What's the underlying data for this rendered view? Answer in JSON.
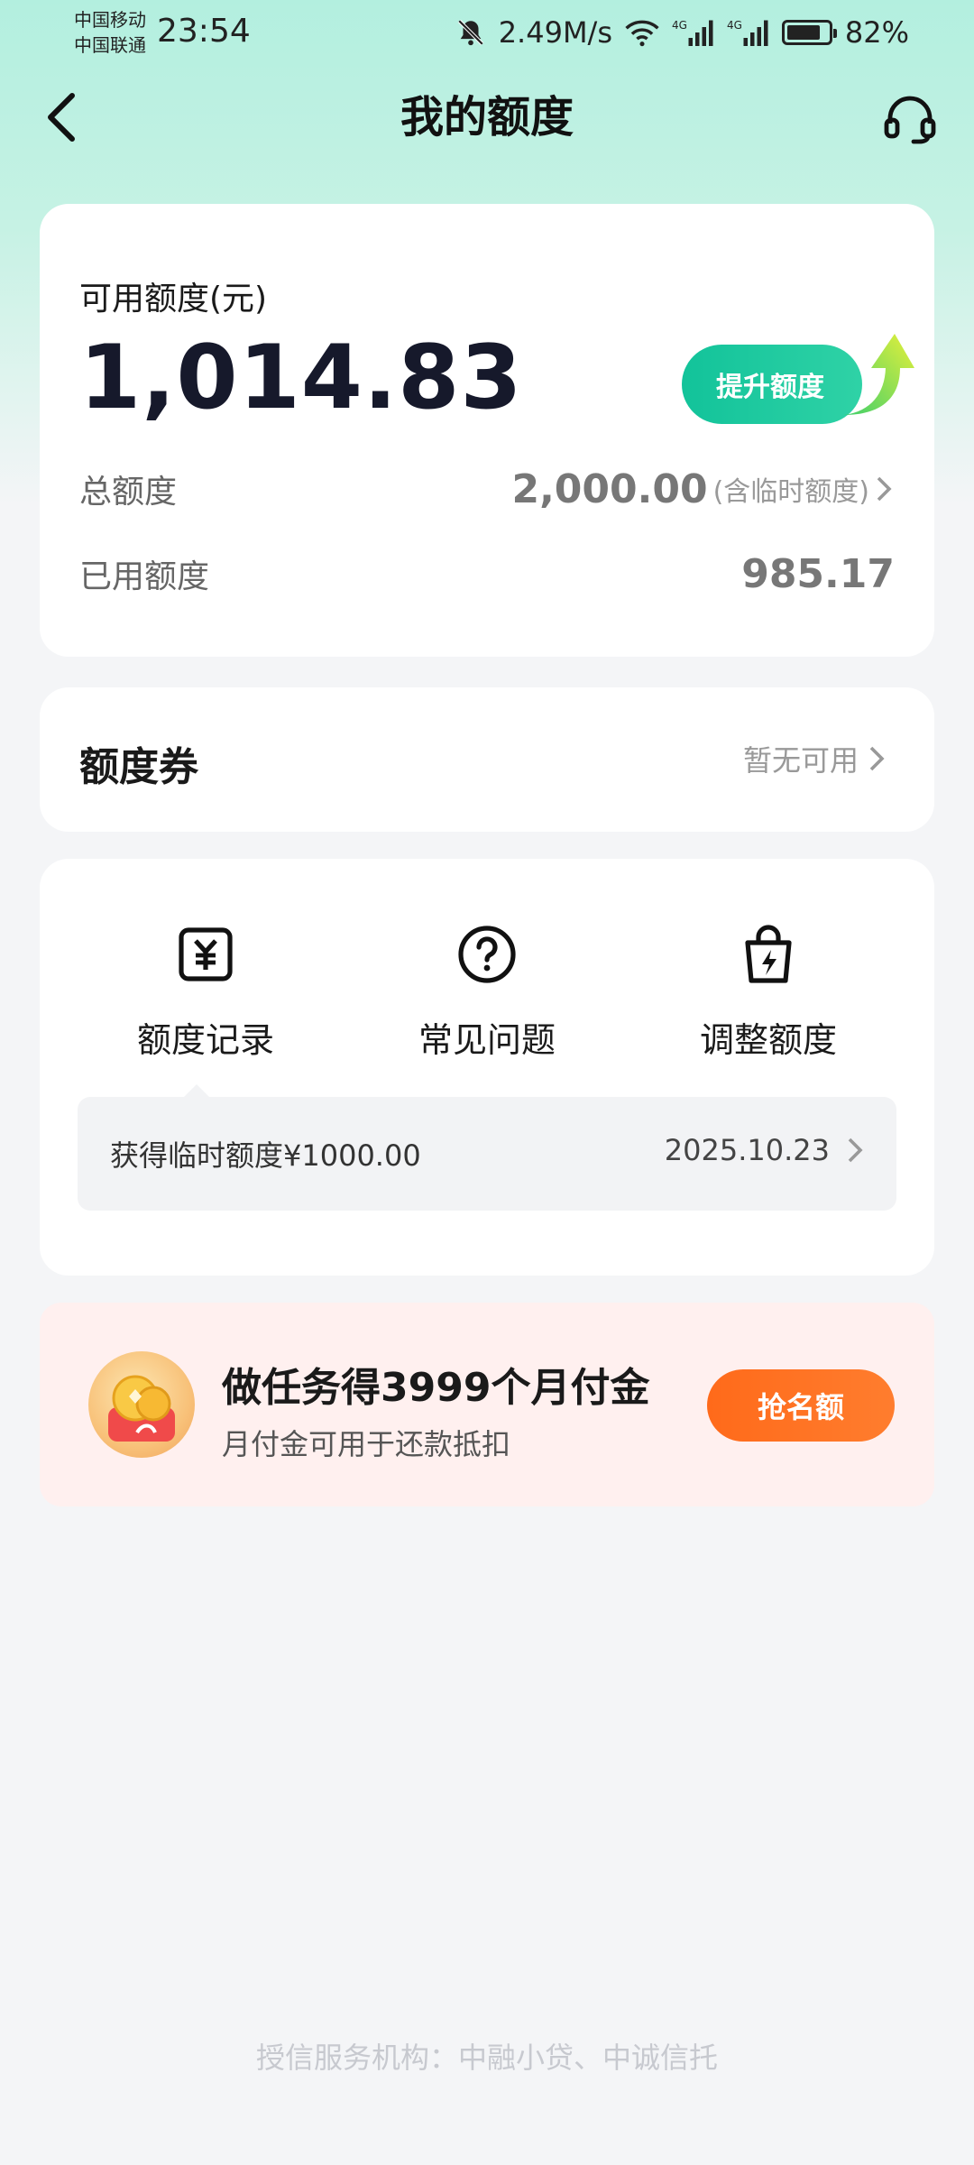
{
  "status_bar": {
    "carrier_1": "中国移动",
    "carrier_2": "中国联通",
    "time": "23:54",
    "speed": "2.49M/s",
    "network_1": "4G",
    "network_2": "4G",
    "battery": "82%",
    "battery_level": 0.82
  },
  "nav": {
    "title": "我的额度"
  },
  "quota": {
    "available_label": "可用额度(元)",
    "available_value": "1,014.83",
    "raise_button": "提升额度",
    "total_label": "总额度",
    "total_value": "2,000.00",
    "total_note": "(含临时额度)",
    "used_label": "已用额度",
    "used_value": "985.17"
  },
  "coupon": {
    "title": "额度券",
    "status": "暂无可用"
  },
  "actions": [
    {
      "label": "额度记录",
      "icon": "yuan-receipt-icon"
    },
    {
      "label": "常见问题",
      "icon": "question-circle-icon"
    },
    {
      "label": "调整额度",
      "icon": "bag-lightning-icon"
    }
  ],
  "record": {
    "text": "获得临时额度¥1000.00",
    "date": "2025.10.23"
  },
  "promo": {
    "title": "做任务得3999个月付金",
    "subtitle": "月付金可用于还款抵扣",
    "button": "抢名额"
  },
  "footer": {
    "text": "授信服务机构：中融小贷、中诚信托"
  },
  "colors": {
    "accent_green": "#12c39a",
    "promo_orange": "#ff6a1a",
    "header_gradient": "#b3efdf"
  }
}
